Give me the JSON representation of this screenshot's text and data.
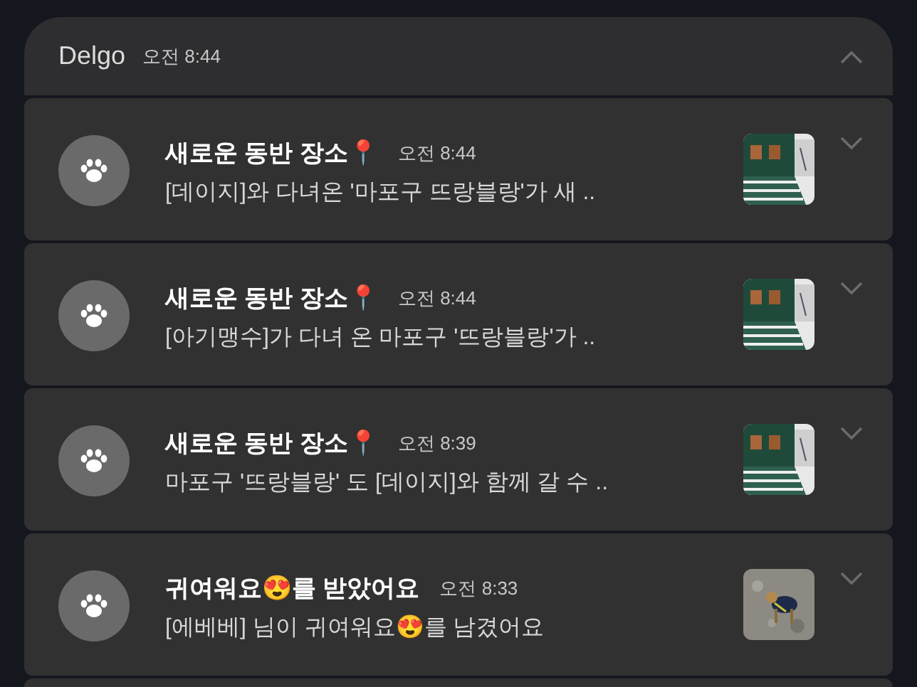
{
  "group": {
    "app": "Delgo",
    "time": "오전 8:44",
    "expanded": true
  },
  "notifications": [
    {
      "title": "새로운 동반 장소📍",
      "time": "오전 8:44",
      "body": "[데이지]와 다녀온 '마포구 뜨랑블랑'가 새 .."
    },
    {
      "title": "새로운 동반 장소📍",
      "time": "오전 8:44",
      "body": "[아기맹수]가 다녀 온 마포구 '뜨랑블랑'가 .."
    },
    {
      "title": "새로운 동반 장소📍",
      "time": "오전 8:39",
      "body": "마포구 '뜨랑블랑' 도 [데이지]와 함께 갈 수 .."
    },
    {
      "title": "귀여워요😍를 받았어요",
      "time": "오전 8:33",
      "body": "[에베베] 님이 귀여워요😍를 남겼어요"
    }
  ]
}
